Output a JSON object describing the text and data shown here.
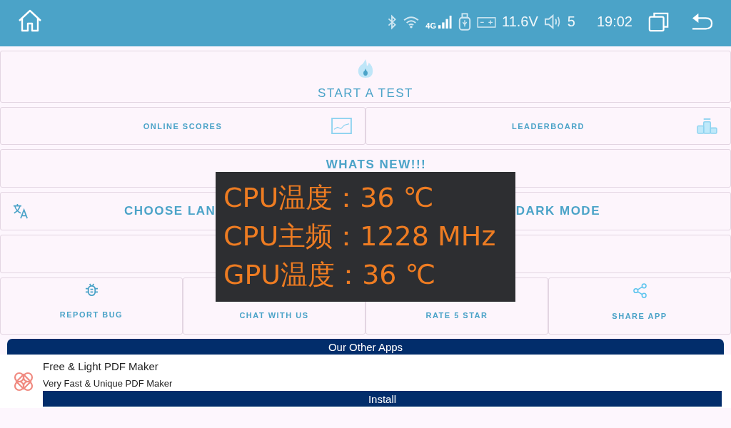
{
  "status_bar": {
    "network": "4G",
    "voltage": "11.6V",
    "volume": "5",
    "time": "19:02"
  },
  "menu": {
    "start": "START A TEST",
    "online_scores": "ONLINE SCORES",
    "leaderboard": "LEADERBOARD",
    "whats_new": "WHATS NEW!!!",
    "language": "CHOOSE LAN",
    "dark_mode": "DARK MODE"
  },
  "tiles": [
    {
      "kind": "bug",
      "label": "REPORT BUG"
    },
    {
      "kind": "chat",
      "label": "CHAT WITH US"
    },
    {
      "kind": "star",
      "label": "RATE 5 STAR"
    },
    {
      "kind": "share",
      "label": "SHARE APP"
    }
  ],
  "overlay": {
    "lines": [
      "CPU温度：36 ℃",
      "CPU主频：1228 MHz",
      "GPU温度：36 ℃"
    ]
  },
  "ad": {
    "header": "Our Other Apps",
    "title": "Free & Light PDF Maker",
    "subtitle": "Very Fast & Unique PDF Maker",
    "button": "Install"
  }
}
